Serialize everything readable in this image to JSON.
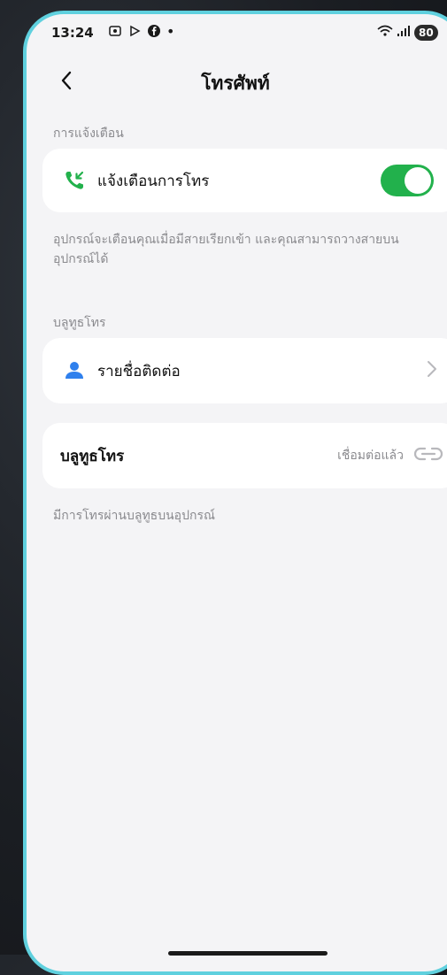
{
  "status_bar": {
    "time": "13:24",
    "battery": "80",
    "icons": [
      "screenshot-icon",
      "play-icon",
      "facebook-icon",
      "wifi-icon",
      "signal-icon"
    ]
  },
  "header": {
    "title": "โทรศัพท์"
  },
  "notifications_section": {
    "label": "การแจ้งเตือน",
    "call_alert": {
      "label": "แจ้งเตือนการโทร",
      "enabled": true,
      "icon": "incoming-call-icon"
    },
    "description": "อุปกรณ์จะเตือนคุณเมื่อมีสายเรียกเข้า และคุณสามารถวางสายบนอุปกรณ์ได้"
  },
  "bluetooth_section": {
    "label": "บลูทูธโทร",
    "contacts": {
      "label": "รายชื่อติดต่อ",
      "icon": "person-icon"
    },
    "bluetooth_call": {
      "label": "บลูทูธโทร",
      "status": "เชื่อมต่อแล้ว"
    },
    "description": "มีการโทรผ่านบลูทูธบนอุปกรณ์"
  },
  "colors": {
    "accent_green": "#22b14c",
    "accent_blue": "#2f80ed",
    "frame": "#5fd0de"
  }
}
